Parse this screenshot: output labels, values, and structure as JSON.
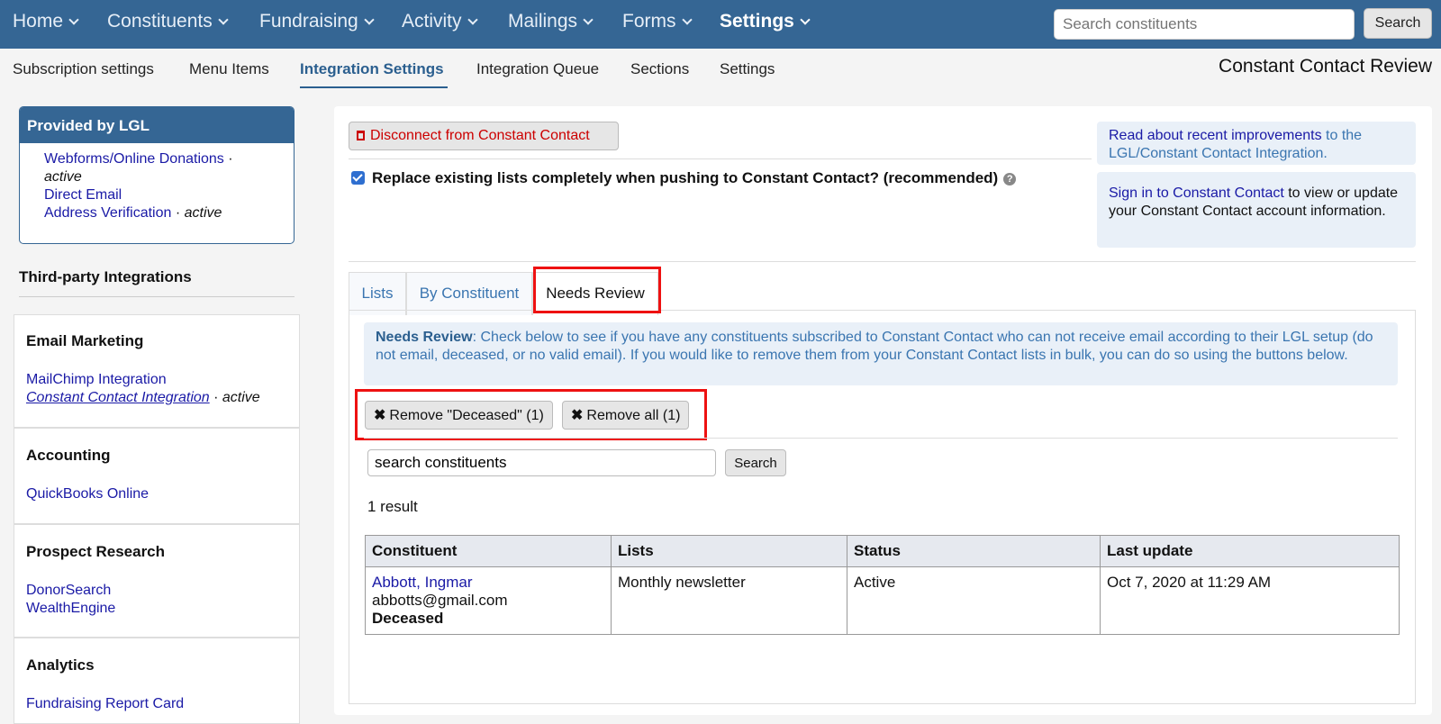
{
  "topnav": {
    "items": [
      {
        "label": "Home",
        "active": false
      },
      {
        "label": "Constituents",
        "active": false
      },
      {
        "label": "Fundraising",
        "active": false
      },
      {
        "label": "Activity",
        "active": false
      },
      {
        "label": "Mailings",
        "active": false
      },
      {
        "label": "Forms",
        "active": false
      },
      {
        "label": "Settings",
        "active": true
      }
    ],
    "search_placeholder": "Search constituents",
    "search_button": "Search"
  },
  "subnav": {
    "items": [
      "Subscription settings",
      "Menu Items",
      "Integration Settings",
      "Integration Queue",
      "Sections",
      "Settings"
    ],
    "active": "Integration Settings",
    "page_title": "Constant Contact Review"
  },
  "sidebar": {
    "provided_title": "Provided by LGL",
    "provided_items": [
      {
        "label": "Webforms/Online Donations",
        "status": "active"
      },
      {
        "label": "Direct Email",
        "status": ""
      },
      {
        "label": "Address Verification",
        "status": "active"
      }
    ],
    "third_party_title": "Third-party Integrations",
    "sections": [
      {
        "title": "Email Marketing",
        "links": [
          {
            "label": "MailChimp Integration",
            "status": ""
          },
          {
            "label": "Constant Contact Integration",
            "status": "active"
          }
        ]
      },
      {
        "title": "Accounting",
        "links": [
          {
            "label": "QuickBooks Online",
            "status": ""
          }
        ]
      },
      {
        "title": "Prospect Research",
        "links": [
          {
            "label": "DonorSearch",
            "status": ""
          },
          {
            "label": "WealthEngine",
            "status": ""
          }
        ]
      },
      {
        "title": "Analytics",
        "links": [
          {
            "label": "Fundraising Report Card",
            "status": ""
          }
        ]
      }
    ],
    "separator": " · "
  },
  "main": {
    "disconnect_label": "Disconnect from Constant Contact",
    "replace_lists_label": "Replace existing lists completely when pushing to Constant Contact? (recommended)",
    "replace_lists_checked": true,
    "info1_link": "Read about recent improvements",
    "info1_rest": " to the LGL/Constant Contact Integration.",
    "info2_link": "Sign in to Constant Contact",
    "info2_rest": " to view or update your Constant Contact account information.",
    "tabs": [
      {
        "label": "Lists",
        "active": false
      },
      {
        "label": "By Constituent",
        "active": false
      },
      {
        "label": "Needs Review",
        "active": true
      }
    ],
    "review_title": "Needs Review",
    "review_text": ": Check below to see if you have any constituents subscribed to Constant Contact who can not receive email according to their LGL setup (do not email, deceased, or no valid email). If you would like to remove them from your Constant Contact lists in bulk, you can do so using the buttons below.",
    "remove_deceased_label": "Remove \"Deceased\" (1)",
    "remove_all_label": "Remove all (1)",
    "search_value": "search constituents",
    "search_button": "Search",
    "result_count": "1 result",
    "table": {
      "headers": [
        "Constituent",
        "Lists",
        "Status",
        "Last update"
      ],
      "rows": [
        {
          "name": "Abbott, Ingmar",
          "email": "abbotts@gmail.com",
          "flag": "Deceased",
          "lists": "Monthly newsletter",
          "status": "Active",
          "last_update": "Oct 7, 2020 at 11:29 AM"
        }
      ]
    }
  },
  "colors": {
    "nav_bg": "#356694",
    "highlight_red": "#ee1111",
    "link_blue": "#1a1aa6",
    "info_bg": "#e9f0f8"
  }
}
